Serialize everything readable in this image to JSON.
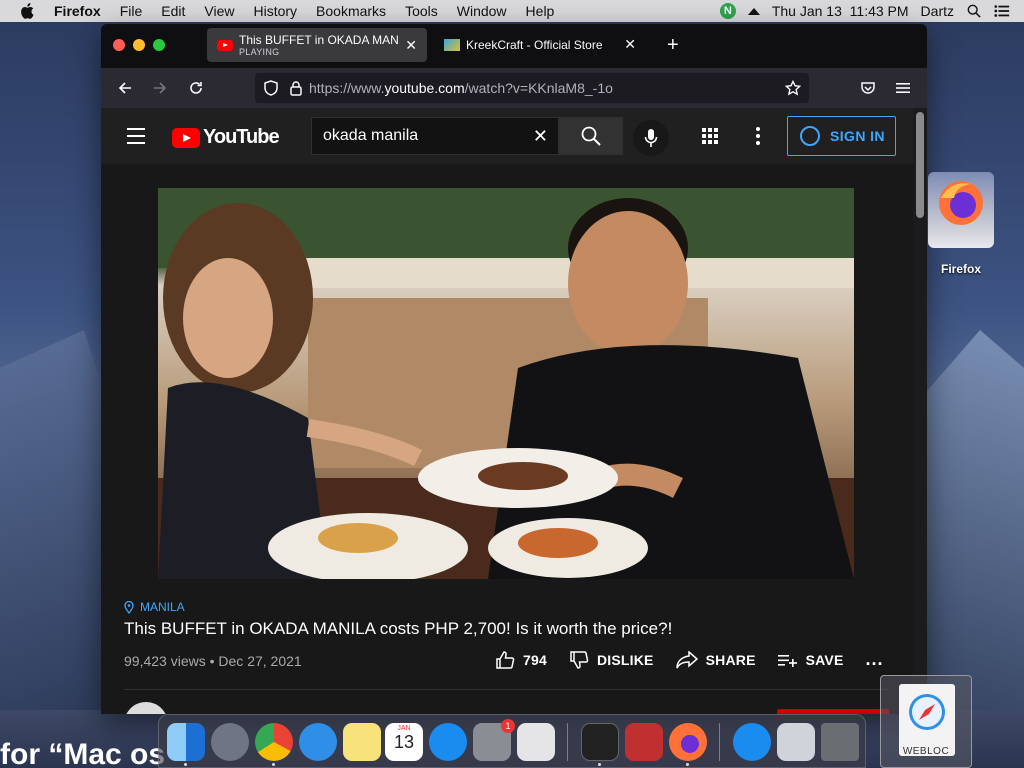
{
  "menubar": {
    "app_name": "Firefox",
    "items": [
      "File",
      "Edit",
      "View",
      "History",
      "Bookmarks",
      "Tools",
      "Window",
      "Help"
    ],
    "datetime": "Thu Jan 13  11:43 PM",
    "user": "Dartz",
    "n_badge": "N"
  },
  "browser": {
    "tabs": [
      {
        "title": "This BUFFET in OKADA MANILA",
        "subtitle": "PLAYING",
        "active": true
      },
      {
        "title": "KreekCraft - Official Store",
        "active": false
      }
    ],
    "url_prefix": "https://www.",
    "url_domain": "youtube.com",
    "url_suffix": "/watch?v=KKnlaM8_-1o"
  },
  "youtube": {
    "logo_text": "YouTube",
    "search_value": "okada manila",
    "sign_in_label": "SIGN IN",
    "video": {
      "location": "MANILA",
      "title": "This BUFFET in OKADA MANILA costs PHP 2,700! Is it worth the price?!",
      "views": "99,423 views",
      "separator": "•",
      "date": "Dec 27, 2021",
      "likes": "794",
      "dislike_label": "DISLIKE",
      "share_label": "SHARE",
      "save_label": "SAVE",
      "more_label": "..."
    }
  },
  "desktop": {
    "firefox_icon_label": "Firefox",
    "webloc_label": "WEBLOC",
    "bottom_text": "for “Mac os"
  },
  "dock": {
    "calendar_month": "JAN",
    "calendar_day": "13",
    "settings_badge": "1"
  },
  "colors": {
    "youtube_red": "#ff0000",
    "link_blue": "#3ea6ff",
    "window_dark": "#1b1b1d",
    "menubar_bg": "#d9d9dc"
  }
}
